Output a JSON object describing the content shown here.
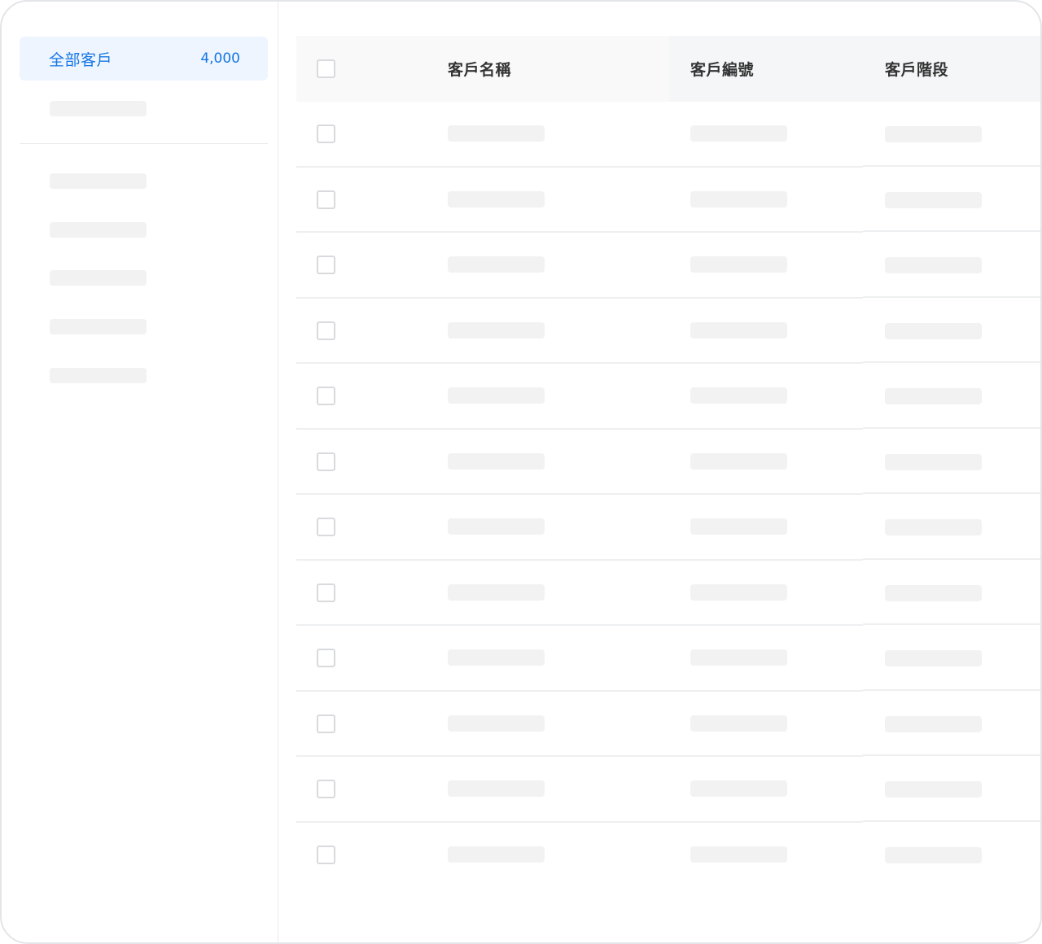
{
  "sidebar": {
    "active_item": {
      "label": "全部客戶",
      "count": "4,000"
    }
  },
  "table": {
    "columns": [
      "客戶名稱",
      "客戶編號",
      "客戶階段"
    ],
    "row_count": 12
  }
}
